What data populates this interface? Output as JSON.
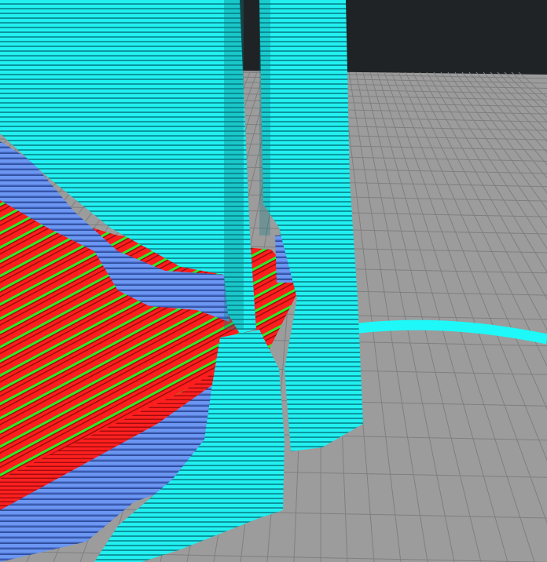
{
  "scene": {
    "kind": "3d-print-slicer-layer-view",
    "colors": {
      "background": "#1f2326",
      "build_plate": "#9a9a9a",
      "grid_line": "#7e7e7e",
      "outer_wall": "#1de9e9",
      "inner_wall": "#5b87ea",
      "infill": "#ff1a1a",
      "top_bottom": "#26f226",
      "skirt": "#1ef5f5"
    }
  }
}
